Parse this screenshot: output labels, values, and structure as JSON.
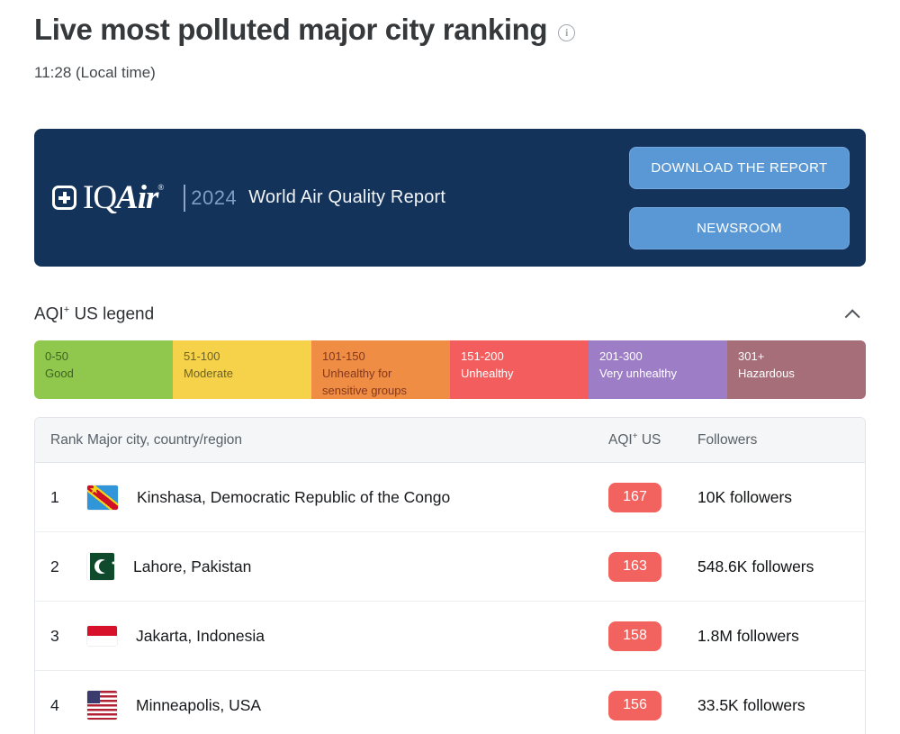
{
  "page": {
    "title": "Live most polluted major city ranking",
    "local_time": "11:28 (Local time)"
  },
  "banner": {
    "logo_iq": "IQ",
    "logo_air": "Air",
    "logo_reg": "®",
    "year": "2024",
    "report_title": "World Air Quality Report",
    "buttons": [
      {
        "label": "DOWNLOAD THE REPORT"
      },
      {
        "label": "NEWSROOM"
      }
    ]
  },
  "legend": {
    "title_base": "AQI",
    "title_sup": "+",
    "title_rest": " US legend",
    "items": [
      {
        "range": "0-50",
        "label": "Good",
        "color": "#90c84e",
        "text_color": "#3f6320"
      },
      {
        "range": "51-100",
        "label": "Moderate",
        "color": "#f5d24a",
        "text_color": "#6e6226"
      },
      {
        "range": "101-150",
        "label": "Unhealthy for sensitive groups",
        "color": "#f08d44",
        "text_color": "#84381d"
      },
      {
        "range": "151-200",
        "label": "Unhealthy",
        "color": "#f45d5d",
        "text_color": "#ffffff"
      },
      {
        "range": "201-300",
        "label": "Very unhealthy",
        "color": "#9d7dc6",
        "text_color": "#ffffff"
      },
      {
        "range": "301+",
        "label": "Hazardous",
        "color": "#a56e79",
        "text_color": "#ffffff"
      }
    ]
  },
  "table": {
    "headers": {
      "rank": "Rank",
      "city": "Major city, country/region",
      "aqi_base": "AQI",
      "aqi_sup": "+",
      "aqi_rest": " US",
      "followers": "Followers"
    },
    "rows": [
      {
        "rank": "1",
        "flag_code": "cd",
        "flag_name": "democratic-republic-of-the-congo",
        "city": "Kinshasa, Democratic Republic of the Congo",
        "aqi": "167",
        "followers": "10K followers"
      },
      {
        "rank": "2",
        "flag_code": "pk",
        "flag_name": "pakistan",
        "city": "Lahore, Pakistan",
        "aqi": "163",
        "followers": "548.6K followers"
      },
      {
        "rank": "3",
        "flag_code": "id",
        "flag_name": "indonesia",
        "city": "Jakarta, Indonesia",
        "aqi": "158",
        "followers": "1.8M followers"
      },
      {
        "rank": "4",
        "flag_code": "us",
        "flag_name": "usa",
        "city": "Minneapolis, USA",
        "aqi": "156",
        "followers": "33.5K followers"
      }
    ]
  },
  "colors": {
    "banner_bg": "#14335a",
    "button_bg": "#5998d4",
    "aqi_badge": "#f2625e",
    "title_text": "#36393c"
  }
}
